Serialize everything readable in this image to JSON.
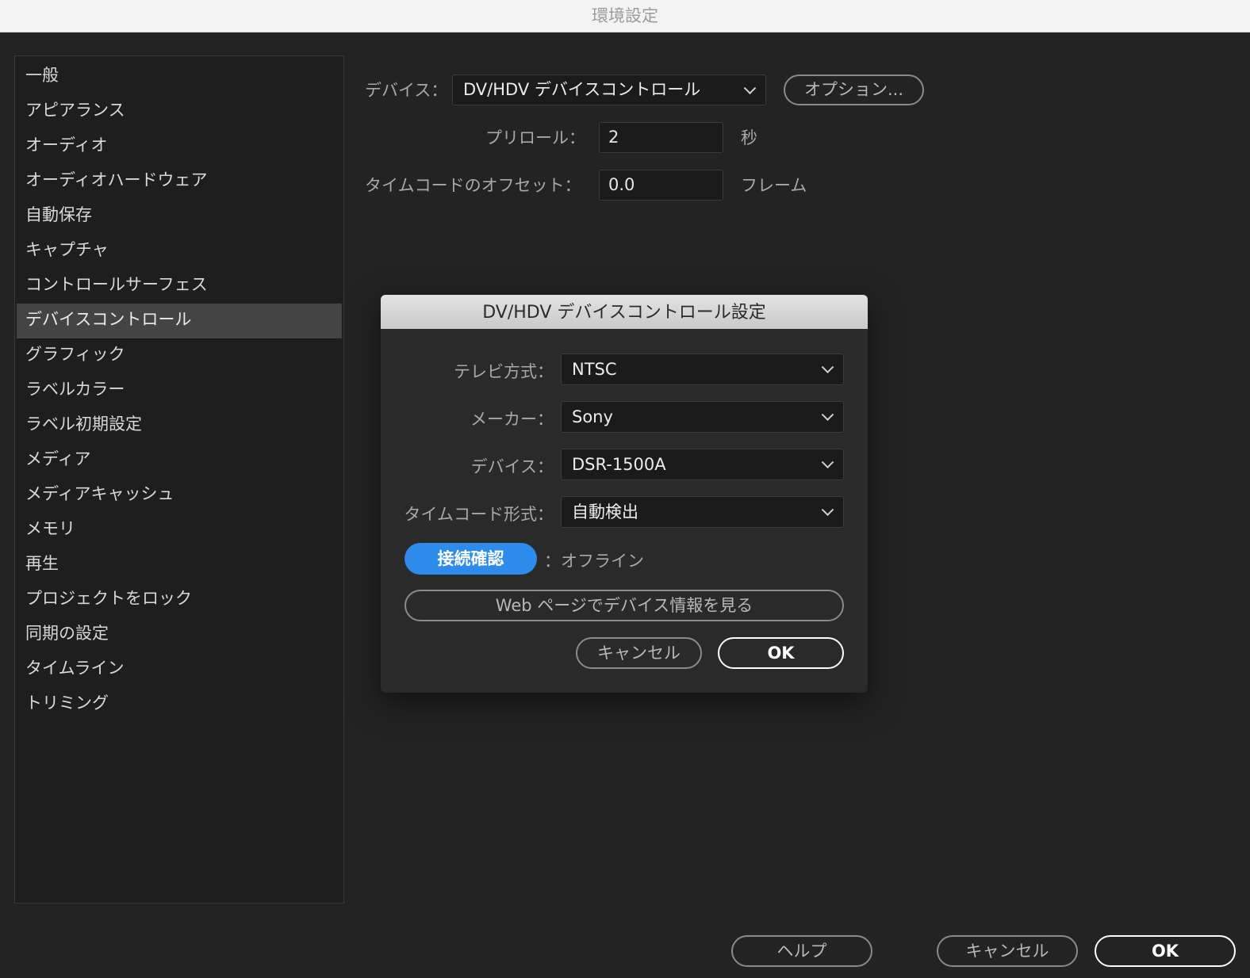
{
  "window": {
    "title": "環境設定"
  },
  "sidebar": {
    "items": [
      {
        "label": "一般"
      },
      {
        "label": "アピアランス"
      },
      {
        "label": "オーディオ"
      },
      {
        "label": "オーディオハードウェア"
      },
      {
        "label": "自動保存"
      },
      {
        "label": "キャプチャ"
      },
      {
        "label": "コントロールサーフェス"
      },
      {
        "label": "デバイスコントロール",
        "selected": true
      },
      {
        "label": "グラフィック"
      },
      {
        "label": "ラベルカラー"
      },
      {
        "label": "ラベル初期設定"
      },
      {
        "label": "メディア"
      },
      {
        "label": "メディアキャッシュ"
      },
      {
        "label": "メモリ"
      },
      {
        "label": "再生"
      },
      {
        "label": "プロジェクトをロック"
      },
      {
        "label": "同期の設定"
      },
      {
        "label": "タイムライン"
      },
      {
        "label": "トリミング"
      }
    ]
  },
  "main": {
    "device_label": "デバイス：",
    "device_value": "DV/HDV デバイスコントロール",
    "options_button": "オプション...",
    "preroll_label": "プリロール：",
    "preroll_value": "2",
    "preroll_unit": "秒",
    "timecode_offset_label": "タイムコードのオフセット：",
    "timecode_offset_value": "0.0",
    "timecode_offset_unit": "フレーム"
  },
  "dialog": {
    "title": "DV/HDV デバイスコントロール設定",
    "tv_system_label": "テレビ方式：",
    "tv_system_value": "NTSC",
    "maker_label": "メーカー：",
    "maker_value": "Sony",
    "device_label": "デバイス：",
    "device_value": "DSR-1500A",
    "timecode_format_label": "タイムコード形式：",
    "timecode_format_value": "自動検出",
    "check_connection_button": "接続確認",
    "status_text": "：オフライン",
    "web_info_button": "Web ページでデバイス情報を見る",
    "cancel_button": "キャンセル",
    "ok_button": "OK"
  },
  "footer": {
    "help_button": "ヘルプ",
    "cancel_button": "キャンセル",
    "ok_button": "OK"
  },
  "colors": {
    "background": "#232323",
    "sidebar_selected": "#444444",
    "accent_blue": "#2d8ceb",
    "dialog_header": "#d6d6d6"
  }
}
